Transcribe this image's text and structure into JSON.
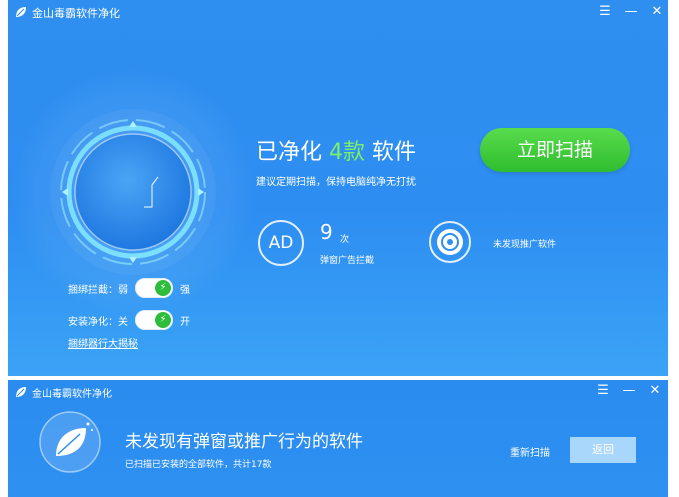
{
  "main_window": {
    "title": "金山毒霸软件净化",
    "controls": {
      "menu": "☰",
      "minimize": "—",
      "close": "✕"
    },
    "headline": {
      "prefix": "已净化",
      "count": "4款",
      "suffix": "软件"
    },
    "subtitle": "建议定期扫描，保持电脑纯净无打扰",
    "scan_button": "立即扫描",
    "ad_stat": {
      "icon_text": "AD",
      "value": "9",
      "unit": "次",
      "label": "弹窗广告拦截"
    },
    "promo_stat": {
      "label": "未发现推广软件"
    },
    "toggles": [
      {
        "label": "捆绑拦截：弱",
        "state_label": "强"
      },
      {
        "label": "安装净化：关",
        "state_label": "开"
      }
    ],
    "reveal_link": "捆绑器行大揭秘",
    "colors": {
      "accent_green": "#3cc43a",
      "count_green": "#7cf06a",
      "bg_blue": "#2f8ff0"
    }
  },
  "popup": {
    "title": "金山毒霸软件净化",
    "controls": {
      "menu": "☰",
      "minimize": "—",
      "close": "✕"
    },
    "heading": "未发现有弹窗或推广行为的软件",
    "subtitle": "已扫描已安装的全部软件，共计17款",
    "rescan_label": "重新扫描",
    "back_label": "返回"
  }
}
